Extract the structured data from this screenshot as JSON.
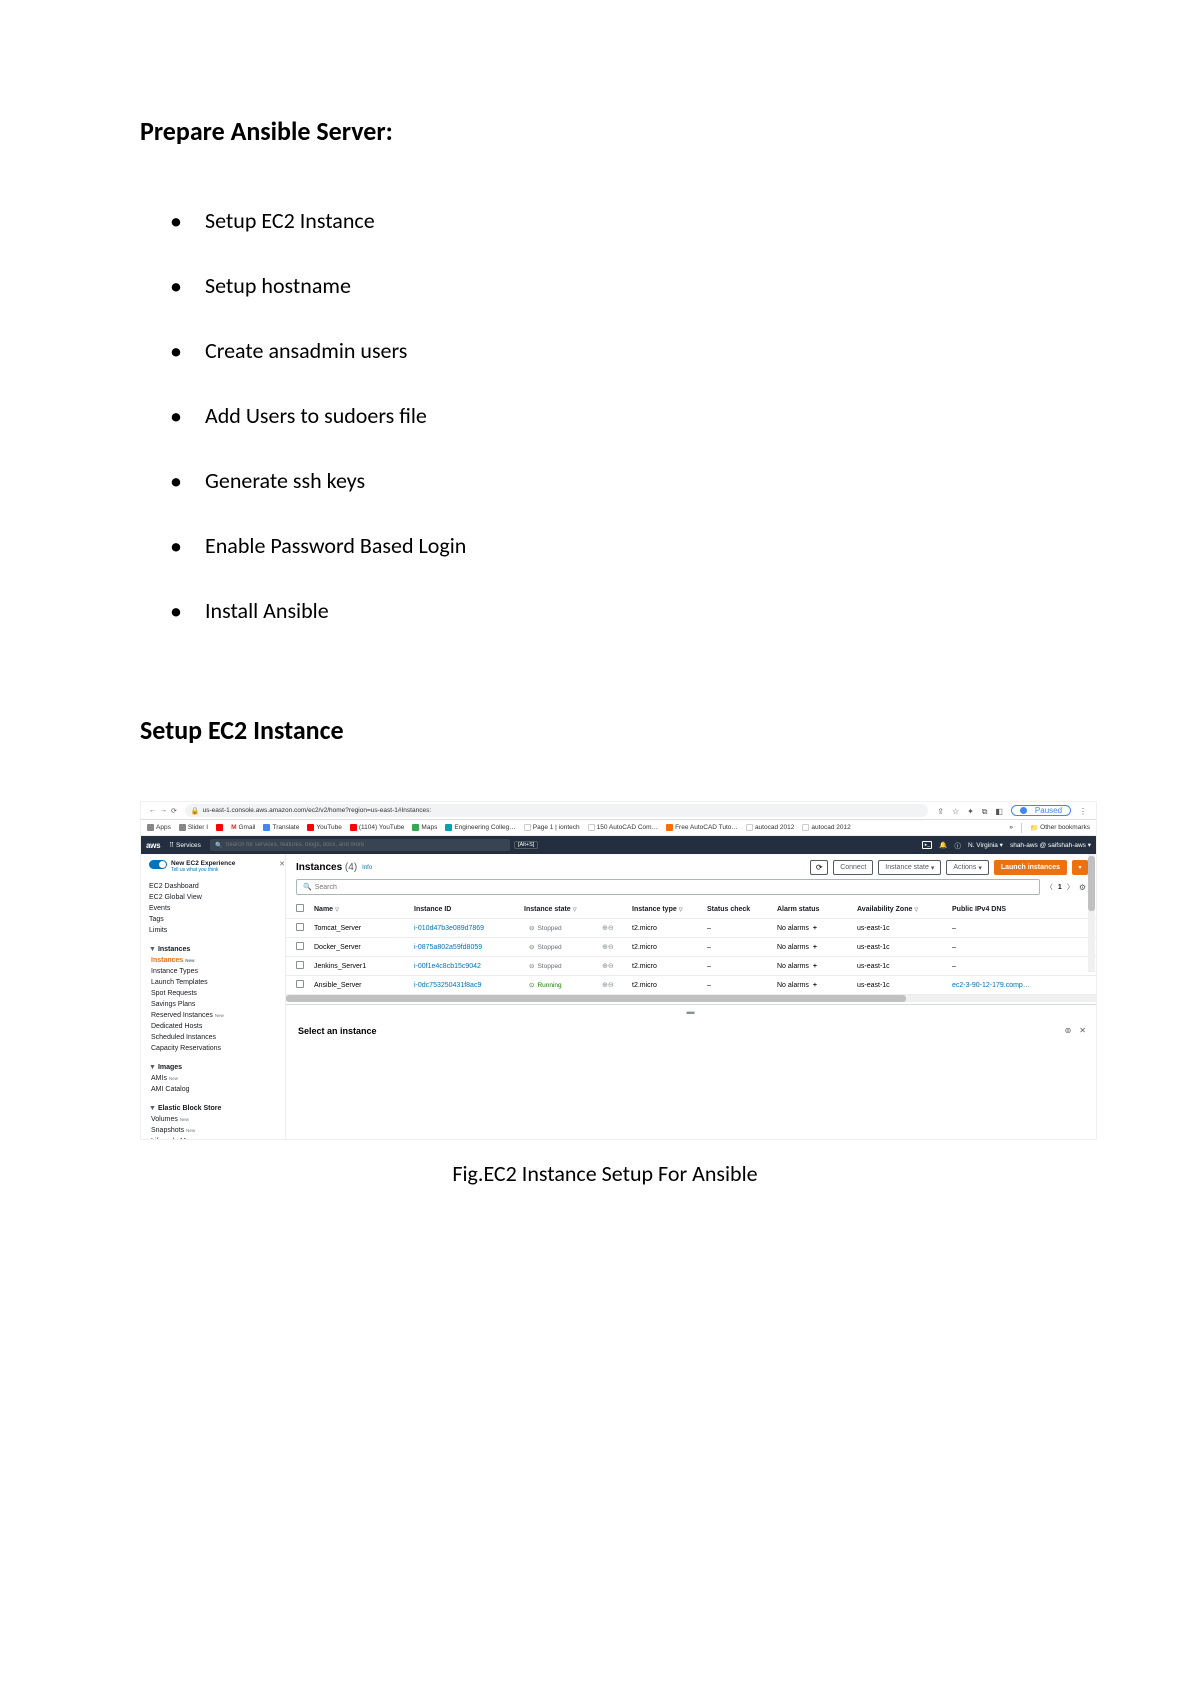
{
  "doc": {
    "title": "Prepare Ansible Server:",
    "bullets": [
      "Setup EC2 Instance",
      "Setup hostname",
      "Create ansadmin users",
      "Add Users to sudoers file",
      "Generate ssh keys",
      "Enable Password Based Login",
      "Install Ansible"
    ],
    "sub_heading": "Setup EC2 Instance",
    "figure_caption": "Fig.EC2 Instance Setup For Ansible"
  },
  "browser": {
    "url": "us-east-1.console.aws.amazon.com/ec2/v2/home?region=us-east-1#Instances:",
    "paused": "Paused",
    "bookmarks": {
      "apps": "Apps",
      "sliderl": "Slider I",
      "gmail": "Gmail",
      "translate": "Translate",
      "youtube": "YouTube",
      "i104": "(1104) YouTube",
      "maps": "Maps",
      "eng": "Engineering Colleg…",
      "page1": "Page 1 | iontech",
      "autocad150": "150 AutoCAD Com…",
      "freetuts": "Free AutoCAD Tuto…",
      "acad2012a": "autocad 2012",
      "acad2012b": "autocad 2012",
      "other": "Other bookmarks"
    }
  },
  "aws_nav": {
    "logo": "aws",
    "services": "Services",
    "search_placeholder": "Search for services, features, blogs, docs, and more",
    "search_hint": "[Alt+S]",
    "region": "N. Virginia",
    "user": "shah-aws @ saifshah-aws"
  },
  "sidebar": {
    "new_exp": "New EC2 Experience",
    "new_exp_sub": "Tell us what you think",
    "items_top": [
      {
        "label": "EC2 Dashboard"
      },
      {
        "label": "EC2 Global View"
      },
      {
        "label": "Events"
      },
      {
        "label": "Tags"
      },
      {
        "label": "Limits"
      }
    ],
    "group_instances": {
      "header": "Instances",
      "items": [
        {
          "label": "Instances",
          "badge": "New",
          "active": true
        },
        {
          "label": "Instance Types"
        },
        {
          "label": "Launch Templates"
        },
        {
          "label": "Spot Requests"
        },
        {
          "label": "Savings Plans"
        },
        {
          "label": "Reserved Instances",
          "badge": "New"
        },
        {
          "label": "Dedicated Hosts"
        },
        {
          "label": "Scheduled Instances"
        },
        {
          "label": "Capacity Reservations"
        }
      ]
    },
    "group_images": {
      "header": "Images",
      "items": [
        {
          "label": "AMIs",
          "badge": "New"
        },
        {
          "label": "AMI Catalog"
        }
      ]
    },
    "group_ebs": {
      "header": "Elastic Block Store",
      "items": [
        {
          "label": "Volumes",
          "badge": "New"
        },
        {
          "label": "Snapshots",
          "badge": "New"
        },
        {
          "label": "Lifecycle Manager",
          "badge": "New"
        }
      ]
    }
  },
  "panel": {
    "title": "Instances",
    "count": "(4)",
    "info": "Info",
    "connect_btn": "Connect",
    "state_btn": "Instance state",
    "actions_btn": "Actions",
    "launch_btn": "Launch instances",
    "search_placeholder": "Search",
    "page": "1",
    "columns": {
      "name": "Name",
      "id": "Instance ID",
      "state": "Instance state",
      "type": "Instance type",
      "status": "Status check",
      "alarm": "Alarm status",
      "az": "Availability Zone",
      "dns": "Public IPv4 DNS"
    },
    "rows": [
      {
        "name": "Tomcat_Server",
        "id": "i-010d47b3e089d7869",
        "state": "Stopped",
        "state_class": "stopped",
        "type": "t2.micro",
        "status": "–",
        "alarm": "No alarms",
        "az": "us-east-1c",
        "dns": "–"
      },
      {
        "name": "Docker_Server",
        "id": "i-0875a802a59fd8059",
        "state": "Stopped",
        "state_class": "stopped",
        "type": "t2.micro",
        "status": "–",
        "alarm": "No alarms",
        "az": "us-east-1c",
        "dns": "–"
      },
      {
        "name": "Jenkins_Server1",
        "id": "i-00f1e4c8cb15c9042",
        "state": "Stopped",
        "state_class": "stopped",
        "type": "t2.micro",
        "status": "–",
        "alarm": "No alarms",
        "az": "us-east-1c",
        "dns": "–"
      },
      {
        "name": "Ansible_Server",
        "id": "i-0dc753250431f8ac9",
        "state": "Running",
        "state_class": "running",
        "type": "t2.micro",
        "status": "–",
        "alarm": "No alarms",
        "az": "us-east-1c",
        "dns": "ec2-3-90-12-179.comp…"
      }
    ],
    "details_title": "Select an instance"
  }
}
